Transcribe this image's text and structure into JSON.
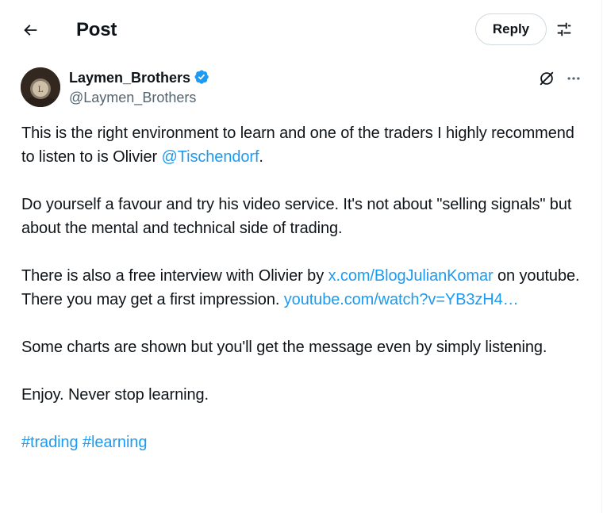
{
  "header": {
    "title": "Post",
    "reply_label": "Reply",
    "back_icon": "arrow-left-icon",
    "settings_icon": "sliders-icon"
  },
  "author": {
    "name": "Laymen_Brothers",
    "handle": "@Laymen_Brothers",
    "verified": true,
    "verified_color": "#1d9bf0",
    "avatar_letter": "L"
  },
  "actions": {
    "grok_icon": "grok-icon",
    "more_icon": "more-horizontal-icon"
  },
  "post": {
    "p1_text": "This is the right environment to learn and one of the traders I highly recommend to listen to is Olivier ",
    "p1_mention": "@Tischendorf",
    "p1_end": ".",
    "p2": "Do yourself a favour and try his video service. It's not about \"selling signals\" but about the mental and technical side of trading.",
    "p3_text": "There is also a free interview with Olivier by ",
    "p3_link1": "x.com/BlogJulianKomar",
    "p3_mid": " on youtube. There you may get a first impression. ",
    "p3_link2": "youtube.com/watch?v=YB3zH4…",
    "p4": "Some charts are shown but you'll get the message even by simply listening.",
    "p5": "Enjoy. Never stop learning.",
    "hashtag1": "#trading",
    "hashtag2": "#learning"
  },
  "colors": {
    "text": "#0f1419",
    "secondary": "#536471",
    "link": "#1d9bf0",
    "border": "#cfd9de"
  }
}
